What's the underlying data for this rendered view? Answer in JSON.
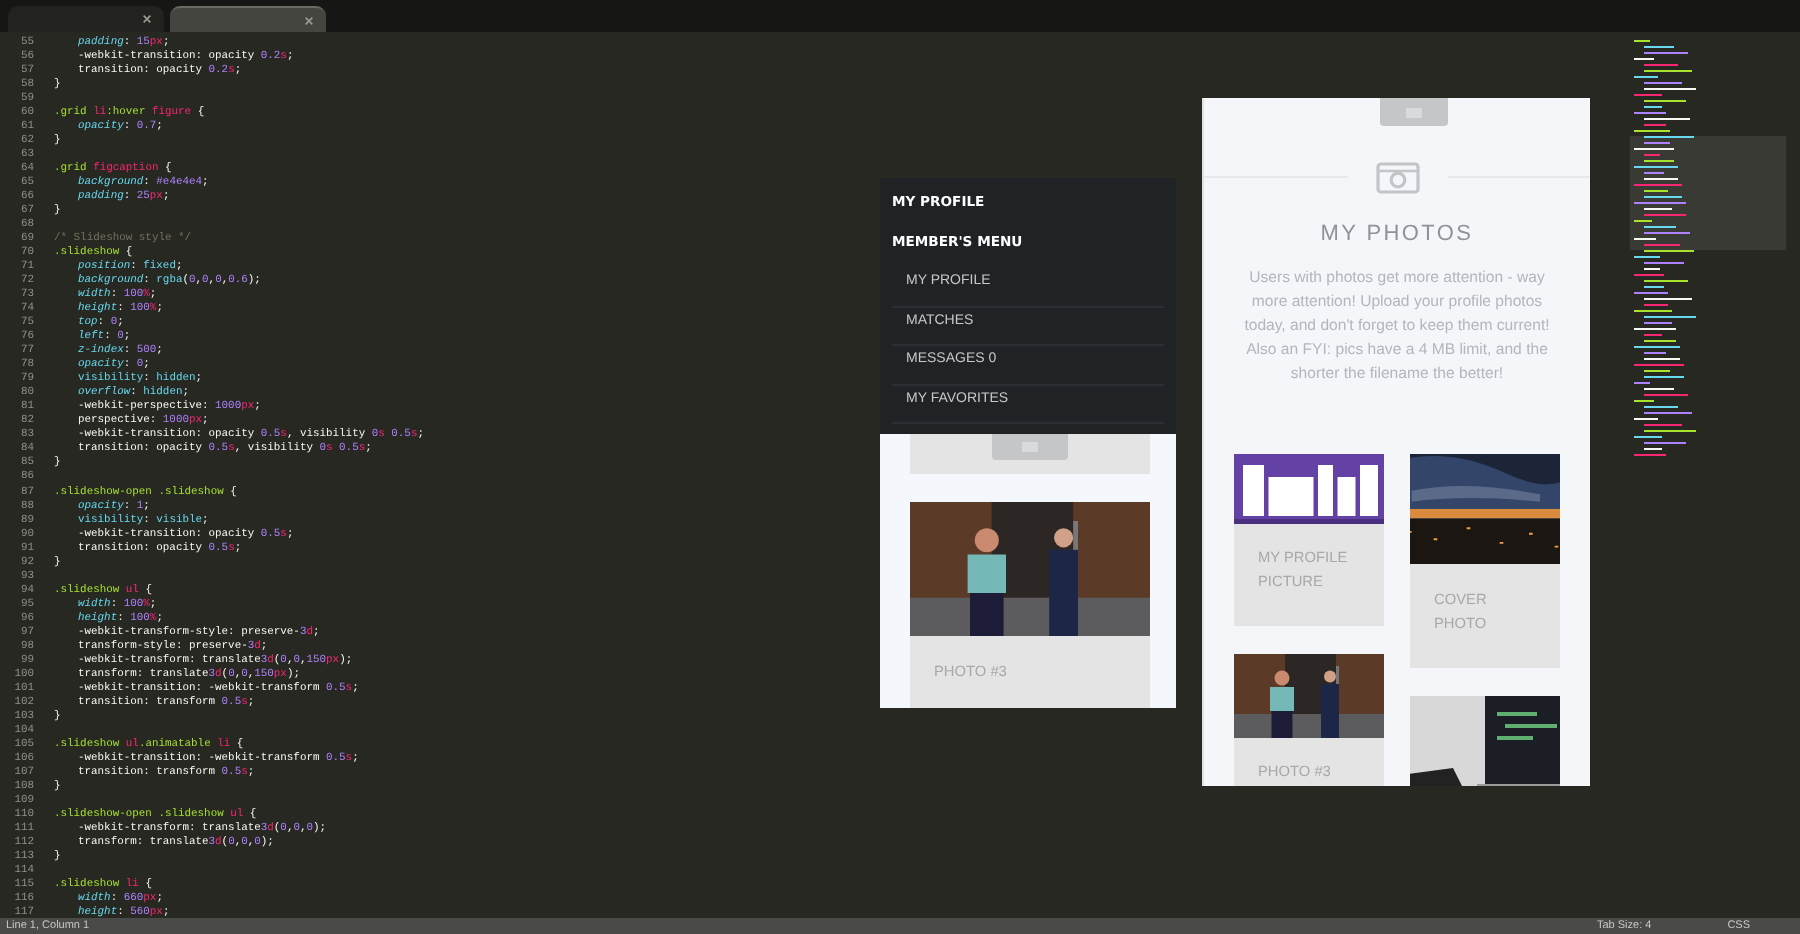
{
  "editor": {
    "tabs": [
      {
        "selected": false
      },
      {
        "selected": true
      }
    ],
    "lines": [
      {
        "number": "55",
        "indent": true,
        "tokens": [
          {
            "kind": "property",
            "text": "padding"
          },
          {
            "kind": "plain",
            "text": ": "
          },
          {
            "kind": "number",
            "text": "15"
          },
          {
            "kind": "unit",
            "text": "px"
          },
          {
            "kind": "plain",
            "text": ";"
          }
        ]
      },
      {
        "number": "56",
        "indent": true,
        "tokens": [
          {
            "kind": "plain",
            "text": "-webkit-transition: opacity "
          },
          {
            "kind": "number",
            "text": "0.2"
          },
          {
            "kind": "unit",
            "text": "s"
          },
          {
            "kind": "plain",
            "text": ";"
          }
        ]
      },
      {
        "number": "57",
        "indent": true,
        "tokens": [
          {
            "kind": "plain",
            "text": "transition: opacity "
          },
          {
            "kind": "number",
            "text": "0.2"
          },
          {
            "kind": "unit",
            "text": "s"
          },
          {
            "kind": "plain",
            "text": ";"
          }
        ]
      },
      {
        "number": "58",
        "indent": false,
        "tokens": [
          {
            "kind": "plain",
            "text": "}"
          }
        ]
      },
      {
        "number": "59"
      },
      {
        "number": "60",
        "indent": false,
        "tokens": [
          {
            "kind": "selector",
            "text": ".grid "
          },
          {
            "kind": "tag",
            "text": "li"
          },
          {
            "kind": "selector",
            "text": ":hover "
          },
          {
            "kind": "tag",
            "text": "figure"
          },
          {
            "kind": "plain",
            "text": " {"
          }
        ]
      },
      {
        "number": "61",
        "indent": true,
        "tokens": [
          {
            "kind": "property",
            "text": "opacity"
          },
          {
            "kind": "plain",
            "text": ": "
          },
          {
            "kind": "number",
            "text": "0.7"
          },
          {
            "kind": "plain",
            "text": ";"
          }
        ]
      },
      {
        "number": "62",
        "indent": false,
        "tokens": [
          {
            "kind": "plain",
            "text": "}"
          }
        ]
      },
      {
        "number": "63"
      },
      {
        "number": "64",
        "indent": false,
        "tokens": [
          {
            "kind": "selector",
            "text": ".grid "
          },
          {
            "kind": "tag",
            "text": "figcaption"
          },
          {
            "kind": "plain",
            "text": " {"
          }
        ]
      },
      {
        "number": "65",
        "indent": true,
        "tokens": [
          {
            "kind": "property",
            "text": "background"
          },
          {
            "kind": "plain",
            "text": ": "
          },
          {
            "kind": "number",
            "text": "#e4e4e4"
          },
          {
            "kind": "plain",
            "text": ";"
          }
        ]
      },
      {
        "number": "66",
        "indent": true,
        "tokens": [
          {
            "kind": "property",
            "text": "padding"
          },
          {
            "kind": "plain",
            "text": ": "
          },
          {
            "kind": "number",
            "text": "25"
          },
          {
            "kind": "unit",
            "text": "px"
          },
          {
            "kind": "plain",
            "text": ";"
          }
        ]
      },
      {
        "number": "67",
        "indent": false,
        "tokens": [
          {
            "kind": "plain",
            "text": "}"
          }
        ]
      },
      {
        "number": "68"
      },
      {
        "number": "69",
        "indent": false,
        "tokens": [
          {
            "kind": "comment",
            "text": "/* Slideshow style */"
          }
        ]
      },
      {
        "number": "70",
        "indent": false,
        "tokens": [
          {
            "kind": "selector",
            "text": ".slideshow"
          },
          {
            "kind": "plain",
            "text": " {"
          }
        ]
      },
      {
        "number": "71",
        "indent": true,
        "tokens": [
          {
            "kind": "property",
            "text": "position"
          },
          {
            "kind": "plain",
            "text": ": "
          },
          {
            "kind": "keyword",
            "text": "fixed"
          },
          {
            "kind": "plain",
            "text": ";"
          }
        ]
      },
      {
        "number": "72",
        "indent": true,
        "tokens": [
          {
            "kind": "property",
            "text": "background"
          },
          {
            "kind": "plain",
            "text": ": "
          },
          {
            "kind": "keyword",
            "text": "rgba"
          },
          {
            "kind": "plain",
            "text": "("
          },
          {
            "kind": "number",
            "text": "0"
          },
          {
            "kind": "plain",
            "text": ","
          },
          {
            "kind": "number",
            "text": "0"
          },
          {
            "kind": "plain",
            "text": ","
          },
          {
            "kind": "number",
            "text": "0"
          },
          {
            "kind": "plain",
            "text": ","
          },
          {
            "kind": "number",
            "text": "0.6"
          },
          {
            "kind": "plain",
            "text": ");"
          }
        ]
      },
      {
        "number": "73",
        "indent": true,
        "tokens": [
          {
            "kind": "property",
            "text": "width"
          },
          {
            "kind": "plain",
            "text": ": "
          },
          {
            "kind": "number",
            "text": "100"
          },
          {
            "kind": "unit",
            "text": "%"
          },
          {
            "kind": "plain",
            "text": ";"
          }
        ]
      },
      {
        "number": "74",
        "indent": true,
        "tokens": [
          {
            "kind": "property",
            "text": "height"
          },
          {
            "kind": "plain",
            "text": ": "
          },
          {
            "kind": "number",
            "text": "100"
          },
          {
            "kind": "unit",
            "text": "%"
          },
          {
            "kind": "plain",
            "text": ";"
          }
        ]
      },
      {
        "number": "75",
        "indent": true,
        "tokens": [
          {
            "kind": "property",
            "text": "top"
          },
          {
            "kind": "plain",
            "text": ": "
          },
          {
            "kind": "number",
            "text": "0"
          },
          {
            "kind": "plain",
            "text": ";"
          }
        ]
      },
      {
        "number": "76",
        "indent": true,
        "tokens": [
          {
            "kind": "property",
            "text": "left"
          },
          {
            "kind": "plain",
            "text": ": "
          },
          {
            "kind": "number",
            "text": "0"
          },
          {
            "kind": "plain",
            "text": ";"
          }
        ]
      },
      {
        "number": "77",
        "indent": true,
        "tokens": [
          {
            "kind": "property",
            "text": "z-index"
          },
          {
            "kind": "plain",
            "text": ": "
          },
          {
            "kind": "number",
            "text": "500"
          },
          {
            "kind": "plain",
            "text": ";"
          }
        ]
      },
      {
        "number": "78",
        "indent": true,
        "tokens": [
          {
            "kind": "property",
            "text": "opacity"
          },
          {
            "kind": "plain",
            "text": ": "
          },
          {
            "kind": "number",
            "text": "0"
          },
          {
            "kind": "plain",
            "text": ";"
          }
        ]
      },
      {
        "number": "79",
        "indent": true,
        "tokens": [
          {
            "kind": "keyword",
            "text": "visibility"
          },
          {
            "kind": "plain",
            "text": ": "
          },
          {
            "kind": "keyword",
            "text": "hidden"
          },
          {
            "kind": "plain",
            "text": ";"
          }
        ]
      },
      {
        "number": "80",
        "indent": true,
        "tokens": [
          {
            "kind": "property",
            "text": "overflow"
          },
          {
            "kind": "plain",
            "text": ": "
          },
          {
            "kind": "keyword",
            "text": "hidden"
          },
          {
            "kind": "plain",
            "text": ";"
          }
        ]
      },
      {
        "number": "81",
        "indent": true,
        "tokens": [
          {
            "kind": "plain",
            "text": "-webkit-perspective: "
          },
          {
            "kind": "number",
            "text": "1000"
          },
          {
            "kind": "unit",
            "text": "px"
          },
          {
            "kind": "plain",
            "text": ";"
          }
        ]
      },
      {
        "number": "82",
        "indent": true,
        "tokens": [
          {
            "kind": "plain",
            "text": "perspective: "
          },
          {
            "kind": "number",
            "text": "1000"
          },
          {
            "kind": "unit",
            "text": "px"
          },
          {
            "kind": "plain",
            "text": ";"
          }
        ]
      },
      {
        "number": "83",
        "indent": true,
        "tokens": [
          {
            "kind": "plain",
            "text": "-webkit-transition: opacity "
          },
          {
            "kind": "number",
            "text": "0.5"
          },
          {
            "kind": "unit",
            "text": "s"
          },
          {
            "kind": "plain",
            "text": ", visibility "
          },
          {
            "kind": "number",
            "text": "0"
          },
          {
            "kind": "unit",
            "text": "s "
          },
          {
            "kind": "number",
            "text": "0.5"
          },
          {
            "kind": "unit",
            "text": "s"
          },
          {
            "kind": "plain",
            "text": ";"
          }
        ]
      },
      {
        "number": "84",
        "indent": true,
        "tokens": [
          {
            "kind": "plain",
            "text": "transition: opacity "
          },
          {
            "kind": "number",
            "text": "0.5"
          },
          {
            "kind": "unit",
            "text": "s"
          },
          {
            "kind": "plain",
            "text": ", visibility "
          },
          {
            "kind": "number",
            "text": "0"
          },
          {
            "kind": "unit",
            "text": "s "
          },
          {
            "kind": "number",
            "text": "0.5"
          },
          {
            "kind": "unit",
            "text": "s"
          },
          {
            "kind": "plain",
            "text": ";"
          }
        ]
      },
      {
        "number": "85",
        "indent": false,
        "tokens": [
          {
            "kind": "plain",
            "text": "}"
          }
        ]
      },
      {
        "number": "86"
      },
      {
        "number": "87",
        "indent": false,
        "tokens": [
          {
            "kind": "selector",
            "text": ".slideshow-open .slideshow"
          },
          {
            "kind": "plain",
            "text": " {"
          }
        ]
      },
      {
        "number": "88",
        "indent": true,
        "tokens": [
          {
            "kind": "property",
            "text": "opacity"
          },
          {
            "kind": "plain",
            "text": ": "
          },
          {
            "kind": "number",
            "text": "1"
          },
          {
            "kind": "plain",
            "text": ";"
          }
        ]
      },
      {
        "number": "89",
        "indent": true,
        "tokens": [
          {
            "kind": "keyword",
            "text": "visibility"
          },
          {
            "kind": "plain",
            "text": ": "
          },
          {
            "kind": "keyword",
            "text": "visible"
          },
          {
            "kind": "plain",
            "text": ";"
          }
        ]
      },
      {
        "number": "90",
        "indent": true,
        "tokens": [
          {
            "kind": "plain",
            "text": "-webkit-transition: opacity "
          },
          {
            "kind": "number",
            "text": "0.5"
          },
          {
            "kind": "unit",
            "text": "s"
          },
          {
            "kind": "plain",
            "text": ";"
          }
        ]
      },
      {
        "number": "91",
        "indent": true,
        "tokens": [
          {
            "kind": "plain",
            "text": "transition: opacity "
          },
          {
            "kind": "number",
            "text": "0.5"
          },
          {
            "kind": "unit",
            "text": "s"
          },
          {
            "kind": "plain",
            "text": ";"
          }
        ]
      },
      {
        "number": "92",
        "indent": false,
        "tokens": [
          {
            "kind": "plain",
            "text": "}"
          }
        ]
      },
      {
        "number": "93"
      },
      {
        "number": "94",
        "indent": false,
        "tokens": [
          {
            "kind": "selector",
            "text": ".slideshow "
          },
          {
            "kind": "tag",
            "text": "ul"
          },
          {
            "kind": "plain",
            "text": " {"
          }
        ]
      },
      {
        "number": "95",
        "indent": true,
        "tokens": [
          {
            "kind": "property",
            "text": "width"
          },
          {
            "kind": "plain",
            "text": ": "
          },
          {
            "kind": "number",
            "text": "100"
          },
          {
            "kind": "unit",
            "text": "%"
          },
          {
            "kind": "plain",
            "text": ";"
          }
        ]
      },
      {
        "number": "96",
        "indent": true,
        "tokens": [
          {
            "kind": "property",
            "text": "height"
          },
          {
            "kind": "plain",
            "text": ": "
          },
          {
            "kind": "number",
            "text": "100"
          },
          {
            "kind": "unit",
            "text": "%"
          },
          {
            "kind": "plain",
            "text": ";"
          }
        ]
      },
      {
        "number": "97",
        "indent": true,
        "tokens": [
          {
            "kind": "plain",
            "text": "-webkit-transform-style: preserve-"
          },
          {
            "kind": "number",
            "text": "3"
          },
          {
            "kind": "unit",
            "text": "d"
          },
          {
            "kind": "plain",
            "text": ";"
          }
        ]
      },
      {
        "number": "98",
        "indent": true,
        "tokens": [
          {
            "kind": "plain",
            "text": "transform-style: preserve-"
          },
          {
            "kind": "number",
            "text": "3"
          },
          {
            "kind": "unit",
            "text": "d"
          },
          {
            "kind": "plain",
            "text": ";"
          }
        ]
      },
      {
        "number": "99",
        "indent": true,
        "tokens": [
          {
            "kind": "plain",
            "text": "-webkit-transform: translate"
          },
          {
            "kind": "number",
            "text": "3"
          },
          {
            "kind": "unit",
            "text": "d"
          },
          {
            "kind": "plain",
            "text": "("
          },
          {
            "kind": "number",
            "text": "0"
          },
          {
            "kind": "plain",
            "text": ","
          },
          {
            "kind": "number",
            "text": "0"
          },
          {
            "kind": "plain",
            "text": ","
          },
          {
            "kind": "number",
            "text": "150"
          },
          {
            "kind": "unit",
            "text": "px"
          },
          {
            "kind": "plain",
            "text": ");"
          }
        ]
      },
      {
        "number": "100",
        "indent": true,
        "tokens": [
          {
            "kind": "plain",
            "text": "transform: translate"
          },
          {
            "kind": "number",
            "text": "3"
          },
          {
            "kind": "unit",
            "text": "d"
          },
          {
            "kind": "plain",
            "text": "("
          },
          {
            "kind": "number",
            "text": "0"
          },
          {
            "kind": "plain",
            "text": ","
          },
          {
            "kind": "number",
            "text": "0"
          },
          {
            "kind": "plain",
            "text": ","
          },
          {
            "kind": "number",
            "text": "150"
          },
          {
            "kind": "unit",
            "text": "px"
          },
          {
            "kind": "plain",
            "text": ");"
          }
        ]
      },
      {
        "number": "101",
        "indent": true,
        "tokens": [
          {
            "kind": "plain",
            "text": "-webkit-transition: -webkit-transform "
          },
          {
            "kind": "number",
            "text": "0.5"
          },
          {
            "kind": "unit",
            "text": "s"
          },
          {
            "kind": "plain",
            "text": ";"
          }
        ]
      },
      {
        "number": "102",
        "indent": true,
        "tokens": [
          {
            "kind": "plain",
            "text": "transition: transform "
          },
          {
            "kind": "number",
            "text": "0.5"
          },
          {
            "kind": "unit",
            "text": "s"
          },
          {
            "kind": "plain",
            "text": ";"
          }
        ]
      },
      {
        "number": "103",
        "indent": false,
        "tokens": [
          {
            "kind": "plain",
            "text": "}"
          }
        ]
      },
      {
        "number": "104"
      },
      {
        "number": "105",
        "indent": false,
        "tokens": [
          {
            "kind": "selector",
            "text": ".slideshow "
          },
          {
            "kind": "tag",
            "text": "ul"
          },
          {
            "kind": "selector",
            "text": ".animatable "
          },
          {
            "kind": "tag",
            "text": "li"
          },
          {
            "kind": "plain",
            "text": " {"
          }
        ]
      },
      {
        "number": "106",
        "indent": true,
        "tokens": [
          {
            "kind": "plain",
            "text": "-webkit-transition: -webkit-transform "
          },
          {
            "kind": "number",
            "text": "0.5"
          },
          {
            "kind": "unit",
            "text": "s"
          },
          {
            "kind": "plain",
            "text": ";"
          }
        ]
      },
      {
        "number": "107",
        "indent": true,
        "tokens": [
          {
            "kind": "plain",
            "text": "transition: transform "
          },
          {
            "kind": "number",
            "text": "0.5"
          },
          {
            "kind": "unit",
            "text": "s"
          },
          {
            "kind": "plain",
            "text": ";"
          }
        ]
      },
      {
        "number": "108",
        "indent": false,
        "tokens": [
          {
            "kind": "plain",
            "text": "}"
          }
        ]
      },
      {
        "number": "109"
      },
      {
        "number": "110",
        "indent": false,
        "tokens": [
          {
            "kind": "selector",
            "text": ".slideshow-open .slideshow "
          },
          {
            "kind": "tag",
            "text": "ul"
          },
          {
            "kind": "plain",
            "text": " {"
          }
        ]
      },
      {
        "number": "111",
        "indent": true,
        "tokens": [
          {
            "kind": "plain",
            "text": "-webkit-transform: translate"
          },
          {
            "kind": "number",
            "text": "3"
          },
          {
            "kind": "unit",
            "text": "d"
          },
          {
            "kind": "plain",
            "text": "("
          },
          {
            "kind": "number",
            "text": "0"
          },
          {
            "kind": "plain",
            "text": ","
          },
          {
            "kind": "number",
            "text": "0"
          },
          {
            "kind": "plain",
            "text": ","
          },
          {
            "kind": "number",
            "text": "0"
          },
          {
            "kind": "plain",
            "text": ");"
          }
        ]
      },
      {
        "number": "112",
        "indent": true,
        "tokens": [
          {
            "kind": "plain",
            "text": "transform: translate"
          },
          {
            "kind": "number",
            "text": "3"
          },
          {
            "kind": "unit",
            "text": "d"
          },
          {
            "kind": "plain",
            "text": "("
          },
          {
            "kind": "number",
            "text": "0"
          },
          {
            "kind": "plain",
            "text": ","
          },
          {
            "kind": "number",
            "text": "0"
          },
          {
            "kind": "plain",
            "text": ","
          },
          {
            "kind": "number",
            "text": "0"
          },
          {
            "kind": "plain",
            "text": ");"
          }
        ]
      },
      {
        "number": "113",
        "indent": false,
        "tokens": [
          {
            "kind": "plain",
            "text": "}"
          }
        ]
      },
      {
        "number": "114"
      },
      {
        "number": "115",
        "indent": false,
        "tokens": [
          {
            "kind": "selector",
            "text": ".slideshow "
          },
          {
            "kind": "tag",
            "text": "li"
          },
          {
            "kind": "plain",
            "text": " {"
          }
        ]
      },
      {
        "number": "116",
        "indent": true,
        "tokens": [
          {
            "kind": "property",
            "text": "width"
          },
          {
            "kind": "plain",
            "text": ": "
          },
          {
            "kind": "number",
            "text": "660"
          },
          {
            "kind": "unit",
            "text": "px"
          },
          {
            "kind": "plain",
            "text": ";"
          }
        ]
      },
      {
        "number": "117",
        "indent": true,
        "tokens": [
          {
            "kind": "property",
            "text": "height"
          },
          {
            "kind": "plain",
            "text": ": "
          },
          {
            "kind": "number",
            "text": "560"
          },
          {
            "kind": "unit",
            "text": "px"
          },
          {
            "kind": "plain",
            "text": ";"
          }
        ]
      }
    ]
  },
  "menu_preview": {
    "items": [
      {
        "kind": "heading",
        "label": "MY PROFILE"
      },
      {
        "kind": "heading",
        "label": "MEMBER'S MENU"
      },
      {
        "kind": "link",
        "label": "MY PROFILE"
      },
      {
        "kind": "link",
        "label": "MATCHES"
      },
      {
        "kind": "link",
        "label": "MESSAGES 0"
      },
      {
        "kind": "link",
        "label": "MY FAVORITES"
      }
    ],
    "photo": {
      "kind": "picture",
      "caption": "PHOTO #3"
    }
  },
  "photos_preview": {
    "title": "MY PHOTOS",
    "text": "Users with photos get more attention - way more attention! Upload your profile photos today, and don't forget to keep them current! Also an FYI: pics have a 4 MB limit, and the shorter the filename the better!",
    "columns": [
      {
        "cards": [
          {
            "kind": "picture",
            "caption": "MY PROFILE PICTURE"
          },
          {
            "kind": "picture",
            "caption": "PHOTO #3"
          }
        ]
      },
      {
        "cards": [
          {
            "kind": "picture",
            "caption": "COVER PHOTO"
          },
          {
            "kind": "picture"
          }
        ]
      }
    ]
  },
  "status_bar": {
    "position": "Line 1, Column 1",
    "tab_size": "Tab Size: 4",
    "syntax": "CSS"
  }
}
